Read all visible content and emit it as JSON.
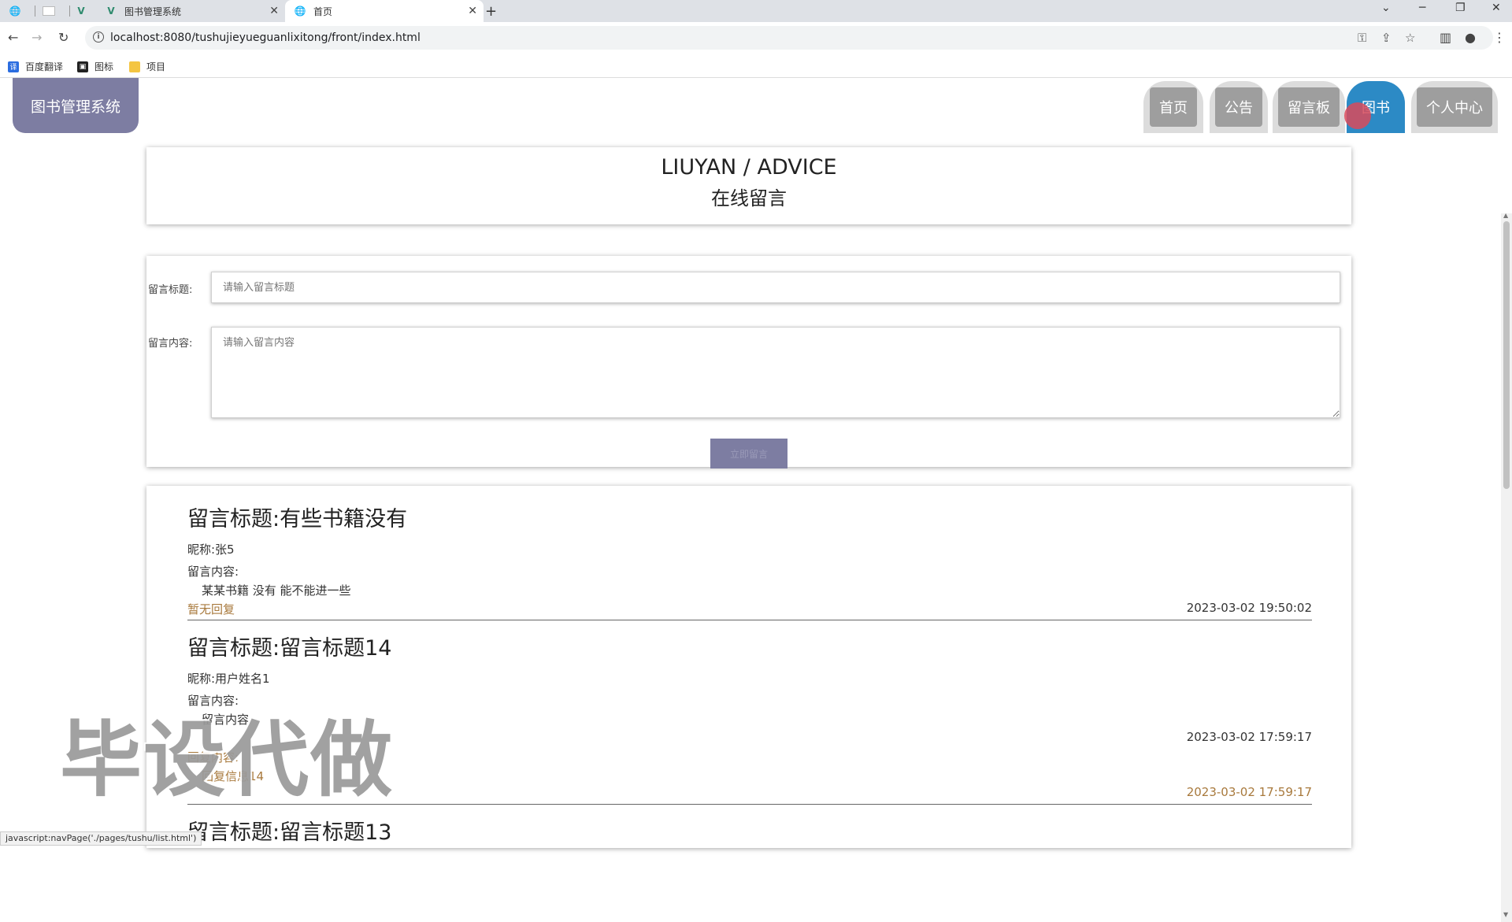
{
  "browser": {
    "tabs": [
      {
        "label": ""
      },
      {
        "label": ""
      },
      {
        "label": ""
      },
      {
        "label": "图书管理系统"
      },
      {
        "label": "首页"
      }
    ],
    "new_tab": "+",
    "url": "localhost:8080/tushujieyueguanlixitong/front/index.html",
    "bookmarks": [
      "百度翻译",
      "图标",
      "项目"
    ]
  },
  "site": {
    "logo": "图书管理系统",
    "nav": [
      "首页",
      "公告",
      "留言板",
      "图书",
      "个人中心"
    ],
    "active_nav": "图书"
  },
  "header": {
    "en": "LIUYAN / ADVICE",
    "zh": "在线留言"
  },
  "form": {
    "title_label": "留言标题:",
    "title_placeholder": "请输入留言标题",
    "content_label": "留言内容:",
    "content_placeholder": "请输入留言内容",
    "submit": "立即留言"
  },
  "messages": [
    {
      "title": "留言标题:有些书籍没有",
      "nickname": "昵称:张5",
      "content_label": "留言内容:",
      "content": "某某书籍 没有 能不能进一些",
      "reply": "暂无回复",
      "time": "2023-03-02 19:50:02"
    },
    {
      "title": "留言标题:留言标题14",
      "nickname": "昵称:用户姓名1",
      "content_label": "留言内容:",
      "content": "留言内容",
      "time": "2023-03-02 17:59:17",
      "reply_label": "回复内容:",
      "reply": "回复信息14",
      "reply_time": "2023-03-02 17:59:17"
    },
    {
      "title": "留言标题:留言标题13"
    }
  ],
  "watermark": "毕设代做",
  "status_url": "javascript:navPage('./pages/tushu/list.html')"
}
